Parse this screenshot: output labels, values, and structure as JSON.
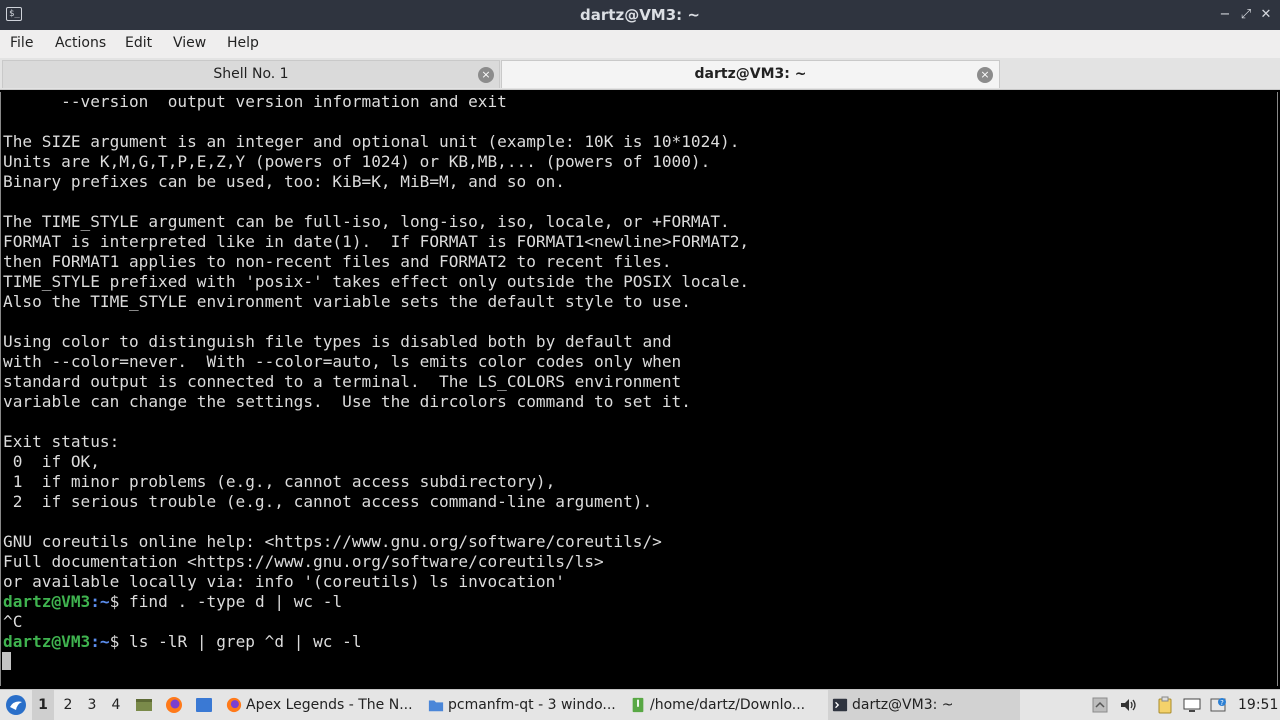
{
  "window": {
    "title": "dartz@VM3: ~",
    "controls": {
      "minimize": "−",
      "maximize": "⤢",
      "close": "✕"
    }
  },
  "menu": [
    "File",
    "Actions",
    "Edit",
    "View",
    "Help"
  ],
  "tabs": [
    {
      "label": "Shell No. 1",
      "active": false,
      "close": "×"
    },
    {
      "label": "dartz@VM3: ~",
      "active": true,
      "close": "×"
    }
  ],
  "terminal": {
    "lines": [
      "      --version  output version information and exit",
      "",
      "The SIZE argument is an integer and optional unit (example: 10K is 10*1024).",
      "Units are K,M,G,T,P,E,Z,Y (powers of 1024) or KB,MB,... (powers of 1000).",
      "Binary prefixes can be used, too: KiB=K, MiB=M, and so on.",
      "",
      "The TIME_STYLE argument can be full-iso, long-iso, iso, locale, or +FORMAT.",
      "FORMAT is interpreted like in date(1).  If FORMAT is FORMAT1<newline>FORMAT2,",
      "then FORMAT1 applies to non-recent files and FORMAT2 to recent files.",
      "TIME_STYLE prefixed with 'posix-' takes effect only outside the POSIX locale.",
      "Also the TIME_STYLE environment variable sets the default style to use.",
      "",
      "Using color to distinguish file types is disabled both by default and",
      "with --color=never.  With --color=auto, ls emits color codes only when",
      "standard output is connected to a terminal.  The LS_COLORS environment",
      "variable can change the settings.  Use the dircolors command to set it.",
      "",
      "Exit status:",
      " 0  if OK,",
      " 1  if minor problems (e.g., cannot access subdirectory),",
      " 2  if serious trouble (e.g., cannot access command-line argument).",
      "",
      "GNU coreutils online help: <https://www.gnu.org/software/coreutils/>",
      "Full documentation <https://www.gnu.org/software/coreutils/ls>",
      "or available locally via: info '(coreutils) ls invocation'"
    ],
    "prompts": [
      {
        "user": "dartz@VM3",
        "path": ":~",
        "dollar": "$ ",
        "command": "find . -type d | wc -l"
      },
      {
        "output": "^C"
      },
      {
        "user": "dartz@VM3",
        "path": ":~",
        "dollar": "$ ",
        "command": "ls -lR | grep ^d | wc -l"
      }
    ],
    "colors": {
      "bg": "#000000",
      "fg": "#dcdcdc",
      "user": "#3fb34f",
      "path": "#5b8ded"
    }
  },
  "taskbar": {
    "workspaces": [
      "1",
      "2",
      "3",
      "4"
    ],
    "active_workspace": "1",
    "tasks": [
      {
        "label": "Apex Legends - The N...",
        "icon": "firefox-icon"
      },
      {
        "label": "pcmanfm-qt - 3 windo...",
        "icon": "folder-icon"
      },
      {
        "label": "/home/dartz/Downlo...",
        "icon": "archive-icon"
      },
      {
        "label": "dartz@VM3: ~",
        "icon": "terminal-icon",
        "active": true
      }
    ],
    "clock": "19:51"
  }
}
